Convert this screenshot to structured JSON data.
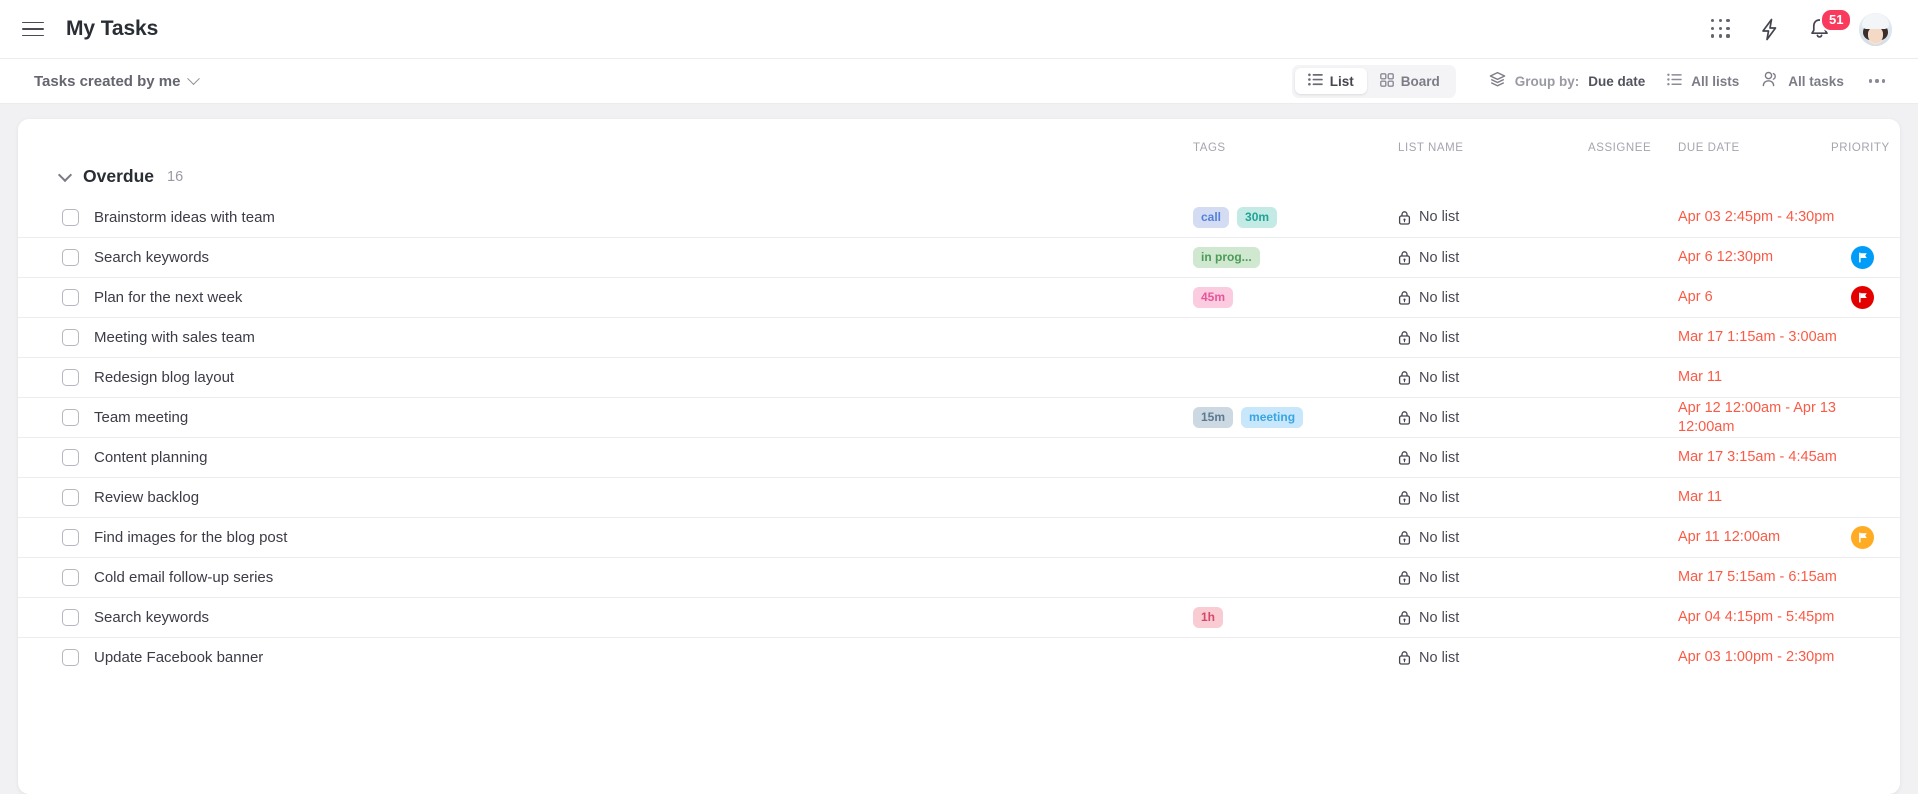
{
  "header": {
    "menu_icon": "hamburger-icon",
    "title": "My Tasks",
    "apps_icon": "apps-grid-icon",
    "bolt_icon": "lightning-bolt-icon",
    "bell_icon": "notification-bell-icon",
    "notification_count": "51",
    "avatar_icon": "user-avatar"
  },
  "toolbar": {
    "view_selector_label": "Tasks created by me",
    "view_selector_chevron": "chevron-down-icon",
    "segments": [
      {
        "label": "List",
        "icon": "list-view-icon",
        "active": true
      },
      {
        "label": "Board",
        "icon": "board-view-icon",
        "active": false
      }
    ],
    "group_by": {
      "icon": "layers-icon",
      "label": "Group by:",
      "value": "Due date"
    },
    "all_lists": {
      "icon": "list-lines-icon",
      "label": "All lists"
    },
    "all_tasks": {
      "icon": "people-icon",
      "label": "All tasks"
    },
    "more_icon": "ellipsis-icon"
  },
  "columns": {
    "tags": "TAGS",
    "list_name": "LIST NAME",
    "assignee": "ASSIGNEE",
    "due_date": "DUE DATE",
    "priority": "PRIORITY"
  },
  "group": {
    "caret_icon": "chevron-down-icon",
    "title": "Overdue",
    "count": "16"
  },
  "colors": {
    "overdue_red": "#fa5b46",
    "badge_red": "#fa3a5c",
    "priority_blue": "#019cf7",
    "priority_red": "#e50000",
    "priority_orange": "#ffab24",
    "text_dark": "#3c3c47",
    "text_muted": "#a5a5af"
  },
  "tasks": [
    {
      "name": "Brainstorm ideas with team",
      "tags": [
        {
          "label": "call",
          "bg": "#d3dcf2",
          "fg": "#5581d8"
        },
        {
          "label": "30m",
          "bg": "#c3eae4",
          "fg": "#21a396"
        }
      ],
      "list_name": "No list",
      "assignee": "",
      "due_date": "Apr 03 2:45pm - 4:30pm",
      "priority": ""
    },
    {
      "name": "Search keywords",
      "tags": [
        {
          "label": "in prog...",
          "bg": "#cfe8cf",
          "fg": "#4c9a58"
        }
      ],
      "list_name": "No list",
      "assignee": "",
      "due_date": "Apr 6 12:30pm",
      "priority": "#019cf7"
    },
    {
      "name": "Plan for the next week",
      "tags": [
        {
          "label": "45m",
          "bg": "#fbccdf",
          "fg": "#e8559b"
        }
      ],
      "list_name": "No list",
      "assignee": "",
      "due_date": "Apr 6",
      "priority": "#e50000"
    },
    {
      "name": "Meeting with sales team",
      "tags": [],
      "list_name": "No list",
      "assignee": "",
      "due_date": "Mar 17 1:15am - 3:00am",
      "priority": ""
    },
    {
      "name": "Redesign blog layout",
      "tags": [],
      "list_name": "No list",
      "assignee": "",
      "due_date": "Mar 11",
      "priority": ""
    },
    {
      "name": "Team meeting",
      "tags": [
        {
          "label": "15m",
          "bg": "#ccd9e3",
          "fg": "#5d7a90"
        },
        {
          "label": "meeting",
          "bg": "#c8e7fa",
          "fg": "#39a5e3"
        }
      ],
      "list_name": "No list",
      "assignee": "",
      "due_date": "Apr 12 12:00am - Apr 13 12:00am",
      "priority": ""
    },
    {
      "name": "Content planning",
      "tags": [],
      "list_name": "No list",
      "assignee": "",
      "due_date": "Mar 17 3:15am - 4:45am",
      "priority": ""
    },
    {
      "name": "Review backlog",
      "tags": [],
      "list_name": "No list",
      "assignee": "",
      "due_date": "Mar 11",
      "priority": ""
    },
    {
      "name": "Find images for the blog post",
      "tags": [],
      "list_name": "No list",
      "assignee": "",
      "due_date": "Apr 11 12:00am",
      "priority": "#ffab24"
    },
    {
      "name": "Cold email follow-up series",
      "tags": [],
      "list_name": "No list",
      "assignee": "",
      "due_date": "Mar 17 5:15am - 6:15am",
      "priority": ""
    },
    {
      "name": "Search keywords",
      "tags": [
        {
          "label": "1h",
          "bg": "#f9ccd4",
          "fg": "#d6486b"
        }
      ],
      "list_name": "No list",
      "assignee": "",
      "due_date": "Apr 04 4:15pm - 5:45pm",
      "priority": ""
    },
    {
      "name": "Update Facebook banner",
      "tags": [],
      "list_name": "No list",
      "assignee": "",
      "due_date": "Apr 03 1:00pm - 2:30pm",
      "priority": ""
    }
  ]
}
